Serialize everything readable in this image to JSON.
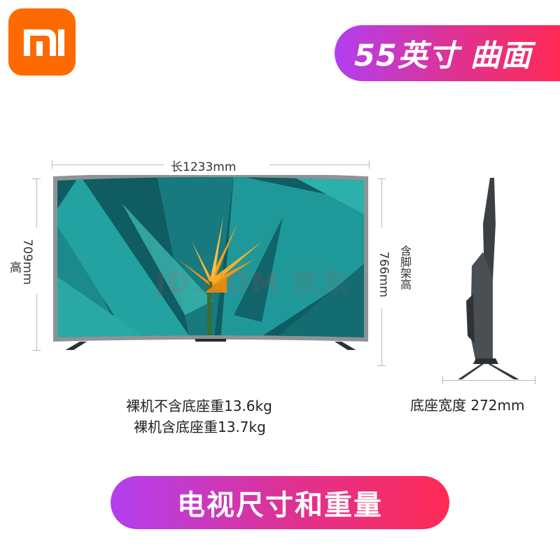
{
  "brand": {
    "logo_text": "MI",
    "logo_color": "#ff6a00"
  },
  "header": {
    "badge_text": "55英寸 曲面"
  },
  "dimensions": {
    "length": "长1233mm",
    "height_mm": "709mm",
    "height_label": "高",
    "height_with_stand_mm": "766mm",
    "height_with_stand_label": "含脚架高",
    "base_width": "底座宽度 272mm"
  },
  "weights": {
    "without_base": "裸机不含底座重13.6kg",
    "with_base": "裸机含底座重13.7kg"
  },
  "watermark": "JD.COM 京东",
  "footer": {
    "badge_text": "电视尺寸和重量"
  },
  "colors": {
    "gradient_start": "#b23ff0",
    "gradient_mid": "#e0318f",
    "gradient_end": "#ff2a55",
    "screen_teal": "#1f8a8a",
    "flower_orange": "#f5a11a"
  }
}
